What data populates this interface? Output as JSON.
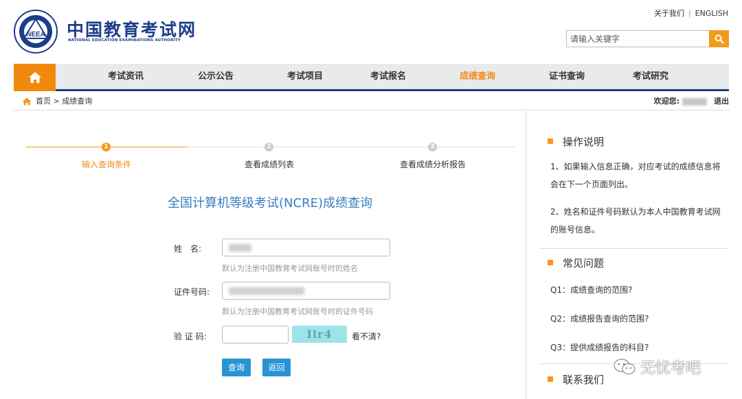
{
  "header": {
    "logo_cn": "中国教育考试网",
    "logo_en": "NATIONAL EDUCATION EXAMINATIONS AUTHORITY",
    "logo_badge": "NEEA",
    "top_links": [
      "关于我们",
      "ENGLISH"
    ],
    "separator": "|",
    "search_placeholder": "请输入关键字"
  },
  "nav": {
    "items": [
      "考试资讯",
      "公示公告",
      "考试项目",
      "考试报名",
      "成绩查询",
      "证书查询",
      "考试研究"
    ],
    "active_index": 4
  },
  "breadcrumb": {
    "trail": "首页 > 成绩查询",
    "welcome": "欢迎您:",
    "logout": "退出"
  },
  "steps": [
    {
      "num": "1",
      "label": "输入查询条件",
      "active": true
    },
    {
      "num": "2",
      "label": "查看成绩列表",
      "active": false
    },
    {
      "num": "3",
      "label": "查看成绩分析报告",
      "active": false
    }
  ],
  "form": {
    "title": "全国计算机等级考试(NCRE)成绩查询",
    "name_label": "姓　名:",
    "name_hint": "默认为注册中国教育考试网账号时的姓名",
    "id_label": "证件号码:",
    "id_hint": "默认为注册中国教育考试网账号时的证件号码",
    "captcha_label": "验 证 码:",
    "captcha_image_text": "Ilr4",
    "refresh_text": "看不清?",
    "submit": "查询",
    "back": "返回"
  },
  "sidebar": {
    "ops_title": "操作说明",
    "ops_items": [
      "1、如果输入信息正确，对应考试的成绩信息将会在下一个页面列出。",
      "2、姓名和证件号码默认为本人中国教育考试网的账号信息。"
    ],
    "faq_title": "常见问题",
    "faq_items": [
      "Q1：成绩查询的范围?",
      "Q2：成绩报告查询的范围?",
      "Q3：提供成绩报告的科目?"
    ],
    "contact_title": "联系我们"
  },
  "watermark": "无忧考吧",
  "colors": {
    "accent": "#f39a1c",
    "nav_active": "#f18a14",
    "brand_blue": "#1d3c8a",
    "title_blue": "#3a7cc0",
    "button_blue": "#2a93d5"
  }
}
